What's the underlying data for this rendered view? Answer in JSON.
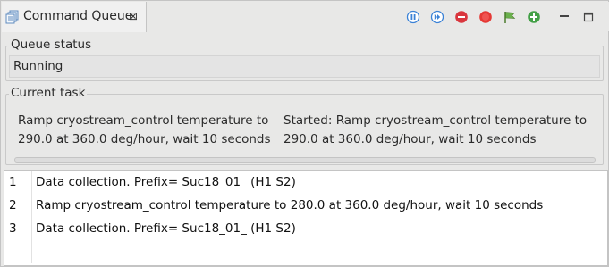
{
  "view": {
    "title": "Command Queue",
    "close_glyph": "⊠"
  },
  "toolbar": {
    "items": [
      {
        "name": "pause-icon",
        "color": "#3b82d6"
      },
      {
        "name": "skip-icon",
        "color": "#3b82d6"
      },
      {
        "name": "remove-icon",
        "color": "#d9363e"
      },
      {
        "name": "stop-icon",
        "color": "#e53935"
      },
      {
        "name": "flag-icon",
        "color": "#6ab04c"
      },
      {
        "name": "add-icon",
        "color": "#43a047"
      },
      {
        "name": "minimize-icon",
        "color": "#444444"
      },
      {
        "name": "maximize-icon",
        "color": "#444444"
      }
    ]
  },
  "queue_status": {
    "legend": "Queue status",
    "value": "Running"
  },
  "current_task": {
    "legend": "Current task",
    "task_line1": "Ramp cryostream_control temperature to",
    "task_line2": "290.0 at 360.0 deg/hour, wait 10 seconds",
    "started_line1": "Started: Ramp cryostream_control temperature to",
    "started_line2": "290.0 at 360.0 deg/hour, wait 10 seconds"
  },
  "queue": {
    "rows": [
      {
        "index": "1",
        "text": "Data collection. Prefix= Suc18_01_ (H1 S2)"
      },
      {
        "index": "2",
        "text": "Ramp cryostream_control temperature to 280.0 at 360.0 deg/hour, wait 10 seconds"
      },
      {
        "index": "3",
        "text": "Data collection. Prefix= Suc18_01_ (H1 S2)"
      }
    ]
  }
}
